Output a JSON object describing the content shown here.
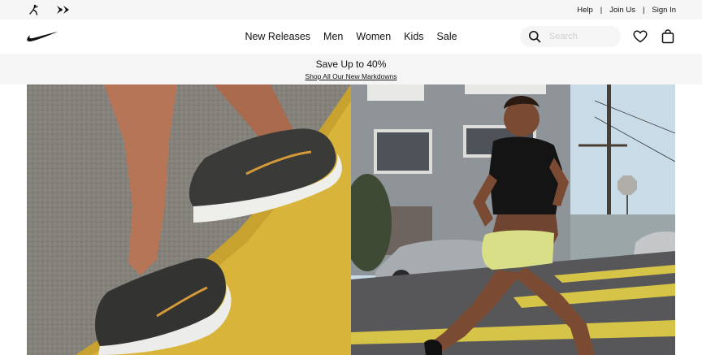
{
  "utility": {
    "brands": [
      {
        "icon": "jordan-jumpman-icon"
      },
      {
        "icon": "converse-star-chevron-icon"
      }
    ],
    "links": [
      {
        "label": "Help"
      },
      {
        "label": "Join Us"
      },
      {
        "label": "Sign In"
      }
    ]
  },
  "nav": {
    "logo": "nike-swoosh-icon",
    "items": [
      {
        "label": "New Releases"
      },
      {
        "label": "Men"
      },
      {
        "label": "Women"
      },
      {
        "label": "Kids"
      },
      {
        "label": "Sale"
      }
    ],
    "search": {
      "placeholder": "Search",
      "value": ""
    },
    "icons": [
      "search-icon",
      "heart-icon",
      "bag-icon"
    ]
  },
  "promo": {
    "headline": "Save Up to 40%",
    "link": "Shop All Our New Markdowns"
  },
  "hero": {
    "left_image": "running-shoes-on-yellow-curb-photo",
    "right_image": "woman-running-city-street-photo"
  },
  "colors": {
    "util_bg": "#f5f5f5",
    "text": "#111111",
    "curb_yellow": "#d9b53a",
    "asphalt": "#8a8680",
    "sky": "#c9dbe6"
  }
}
